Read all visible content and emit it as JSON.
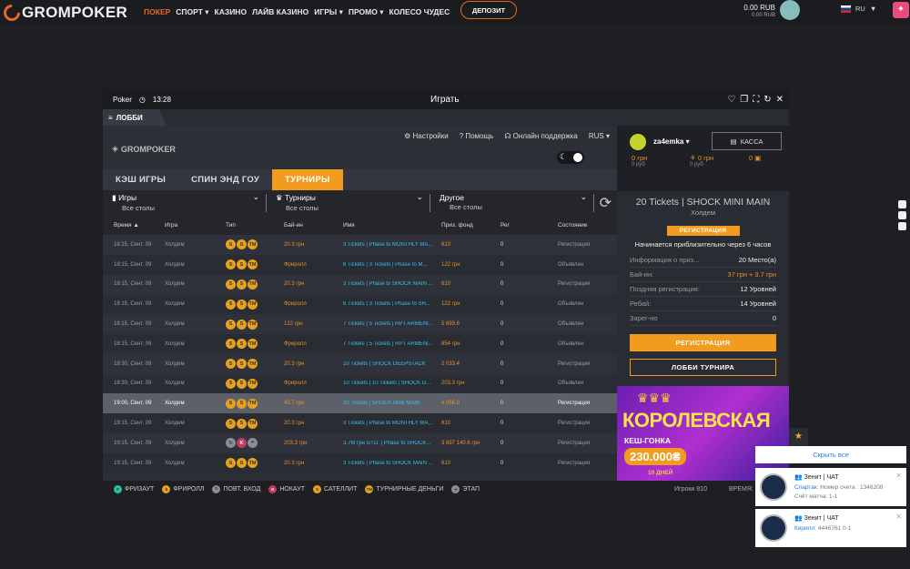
{
  "topbar": {
    "brand": "GROMPOKER",
    "nav": [
      "ПОКЕР",
      "СПОРТ ▾",
      "КАЗИНО",
      "ЛАЙВ КАЗИНО",
      "ИГРЫ ▾",
      "ПРОМО ▾",
      "КОЛЕСО ЧУДЕС"
    ],
    "deposit": "ДЕПОЗИТ",
    "balance_main": "0.00 RUB",
    "balance_sub": "0.00 RUB",
    "lang": "RU"
  },
  "window": {
    "app": "Poker",
    "time": "13:28",
    "title": "Играть",
    "lobby_tab": "ЛОББИ"
  },
  "header": {
    "logo": "GROMPOKER",
    "settings": "Настройки",
    "help": "Помощь",
    "support": "Онлайн поддержка",
    "lang": "RUS ▾"
  },
  "tabs": [
    "КЭШ ИГРЫ",
    "СПИН ЭНД ГОУ",
    "ТУРНИРЫ"
  ],
  "filters": [
    {
      "label": "Игры",
      "value": "Все столы"
    },
    {
      "label": "Турниры",
      "value": "Все столы"
    },
    {
      "label": "Другое",
      "value": "Все столы"
    }
  ],
  "columns": [
    "Время",
    "Игра",
    "Тип",
    "Бай-ин",
    "Имя",
    "Приз. фонд",
    "Рег",
    "Состояние"
  ],
  "rows": [
    {
      "time": "18:15, Сент. 09",
      "game": "Холдем",
      "buyin": "20.3 грн",
      "name": "3 Tickets | Phase to MONTHLY MA...",
      "prize": "610",
      "reg": "0",
      "state": "Регистрация"
    },
    {
      "time": "18:15, Сент. 09",
      "game": "Холдем",
      "buyin": "Фриролл",
      "name": "6 Tickets | 3 Tickets | Phase to M...",
      "prize": "122 грн",
      "reg": "0",
      "state": "Объявлен"
    },
    {
      "time": "18:15, Сент. 09",
      "game": "Холдем",
      "buyin": "20.3 грн",
      "name": "3 Tickets | Phase to SHOCK MAIN ...",
      "prize": "610",
      "reg": "0",
      "state": "Регистрация"
    },
    {
      "time": "18:15, Сент. 09",
      "game": "Холдем",
      "buyin": "Фриролл",
      "name": "6 Tickets | 3 Tickets | Phase to SH...",
      "prize": "122 грн",
      "reg": "0",
      "state": "Объявлен"
    },
    {
      "time": "18:15, Сент. 09",
      "game": "Холдем",
      "buyin": "122 грн",
      "name": "7 Tickets | 5 Tickets | RPT ARMENI...",
      "prize": "5 693.6",
      "reg": "0",
      "state": "Объявлен"
    },
    {
      "time": "18:15, Сент. 09",
      "game": "Холдем",
      "buyin": "Фриролл",
      "name": "7 Tickets | 5 Tickets | RPT ARMENI...",
      "prize": "854 грн",
      "reg": "0",
      "state": "Объявлен"
    },
    {
      "time": "18:30, Сент. 09",
      "game": "Холдем",
      "buyin": "20.3 грн",
      "name": "10 Tickets | SHOCK DEEPSTACK",
      "prize": "2 033.4",
      "reg": "0",
      "state": "Регистрация"
    },
    {
      "time": "18:30, Сент. 09",
      "game": "Холдем",
      "buyin": "Фриролл",
      "name": "10 Tickets | 10 Tickets | SHOCK D...",
      "prize": "203.3 грн",
      "reg": "0",
      "state": "Объявлен"
    },
    {
      "time": "19:00, Сент. 09",
      "game": "Холдем",
      "buyin": "40.7 грн",
      "name": "20 Tickets | SHOCK MINI MAIN",
      "prize": "4 066.9",
      "reg": "0",
      "state": "Регистрация"
    },
    {
      "time": "19:15, Сент. 09",
      "game": "Холдем",
      "buyin": "20.3 грн",
      "name": "3 Tickets | Phase to MONTHLY MA...",
      "prize": "610",
      "reg": "0",
      "state": "Регистрация"
    },
    {
      "time": "19:15, Сент. 09",
      "game": "Холдем",
      "buyin": "203.3 грн",
      "name": "3.7M грн GTD. | Phase to SHOCK...",
      "prize": "3 697 140.6 грн",
      "reg": "0",
      "state": "Регистрация"
    },
    {
      "time": "19:15, Сент. 09",
      "game": "Холдем",
      "buyin": "20.3 грн",
      "name": "3 Tickets | Phase to SHOCK MAIN ...",
      "prize": "610",
      "reg": "0",
      "state": "Регистрация"
    }
  ],
  "side": {
    "username": "za4emka ▾",
    "kassa": "КАССА",
    "money": [
      {
        "v": "0 грн",
        "s": "0 руб"
      },
      {
        "v": "0 грн",
        "s": "0 руб"
      },
      {
        "v": "0",
        "s": ""
      }
    ],
    "t_title": "20 Tickets | SHOCK MINI MAIN",
    "t_game": "Холдем",
    "badge": "РЕГИСТРАЦИЯ",
    "starts": "Начинается приблизительно через 6 часов",
    "info": [
      {
        "k": "Информация о приз...",
        "v": "20 Место(а)"
      },
      {
        "k": "Бай-ин:",
        "v": "37 грн + 3.7 грн"
      },
      {
        "k": "Поздняя регистрация:",
        "v": "12 Уровней"
      },
      {
        "k": "Ребай:",
        "v": "14 Уровней"
      },
      {
        "k": "Зарег-но",
        "v": "0"
      }
    ],
    "btn_reg": "РЕГИСТРАЦИЯ",
    "btn_lobby": "ЛОББИ ТУРНИРА",
    "banner_title": "КОРОЛЕВСКАЯ",
    "banner_sub": "КЕШ-ГОНКА",
    "banner_amount": "230.000₴",
    "banner_days": "10 ДНЕЙ"
  },
  "legend": [
    "ФРИЗАУТ",
    "ФРИРОЛЛ",
    "ПОВТ. ВХОД",
    "НОКАУТ",
    "САТЕЛЛИТ",
    "ТУРНИРНЫЕ ДЕНЬГИ",
    "ЭТАП"
  ],
  "players": "Игроки 810",
  "time_lbl": "ВРЕМЯ:",
  "chat": {
    "hide": "Скрыть все",
    "n1": {
      "title": "Зенит | ЧАТ",
      "user": "Спартак:",
      "msg": "Номер счета : 1346208",
      "extra": "Счёт матча: 1-1"
    },
    "n2": {
      "title": "Зенит | ЧАТ",
      "user": "Кирилл:",
      "msg": "4446761 0-1"
    }
  }
}
